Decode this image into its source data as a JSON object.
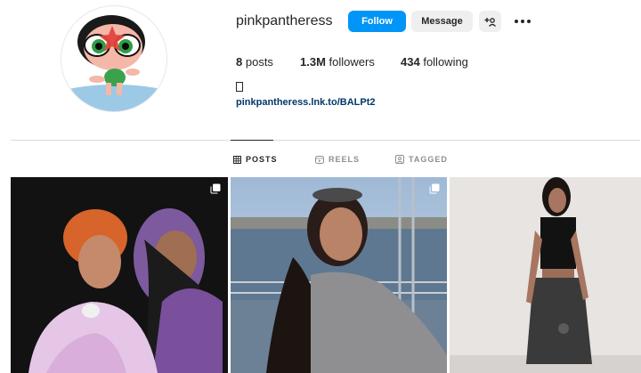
{
  "profile": {
    "username": "pinkpantheress",
    "link": "pinkpantheress.lnk.to/BALPt2",
    "avatar_icon": "powerpuff-buttercup-avatar"
  },
  "actions": {
    "follow_label": "Follow",
    "message_label": "Message",
    "add_user_label": "+B",
    "more_icon": "more-horizontal-icon"
  },
  "stats": {
    "posts_count": "8",
    "posts_label": "posts",
    "followers_count": "1.3M",
    "followers_label": "followers",
    "following_count": "434",
    "following_label": "following"
  },
  "tabs": [
    {
      "label": "POSTS",
      "icon": "grid-icon",
      "active": true
    },
    {
      "label": "REELS",
      "icon": "reels-icon",
      "active": false
    },
    {
      "label": "TAGGED",
      "icon": "tagged-icon",
      "active": false
    }
  ],
  "colors": {
    "accent": "#0095f6",
    "link": "#00376b",
    "button_secondary": "#efefef"
  },
  "posts": [
    {
      "icon": "multiple-images-icon"
    },
    {
      "icon": "multiple-images-icon"
    },
    {
      "icon": ""
    }
  ]
}
